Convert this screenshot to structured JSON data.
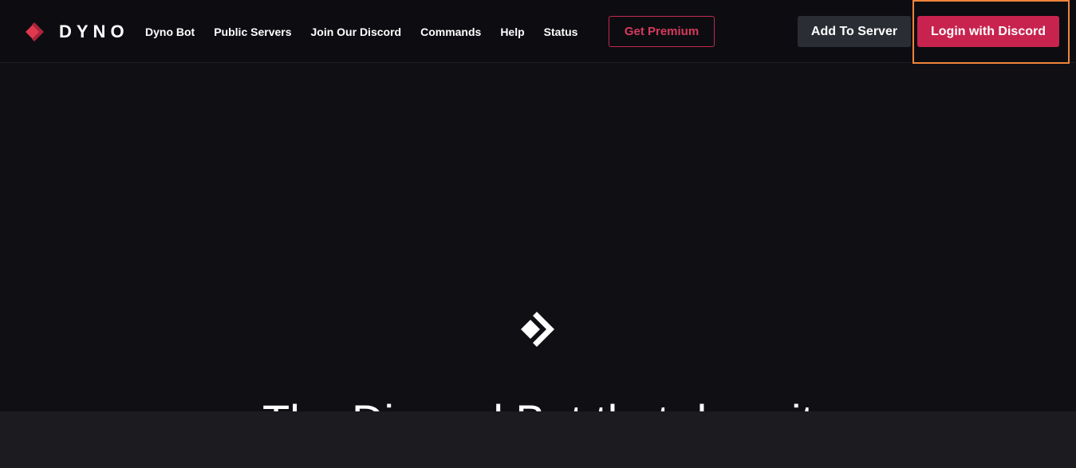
{
  "brand": {
    "name": "DYNO",
    "accent_color": "#c8234f"
  },
  "nav": {
    "links": [
      {
        "label": "Dyno Bot"
      },
      {
        "label": "Public Servers"
      },
      {
        "label": "Join Our Discord"
      },
      {
        "label": "Commands"
      },
      {
        "label": "Help"
      },
      {
        "label": "Status"
      }
    ],
    "premium_label": "Get Premium",
    "add_to_server_label": "Add To Server",
    "login_label": "Login with Discord"
  },
  "hero": {
    "logo_icon": "dyno-logo-icon",
    "title": "The Discord Bot that does it"
  }
}
